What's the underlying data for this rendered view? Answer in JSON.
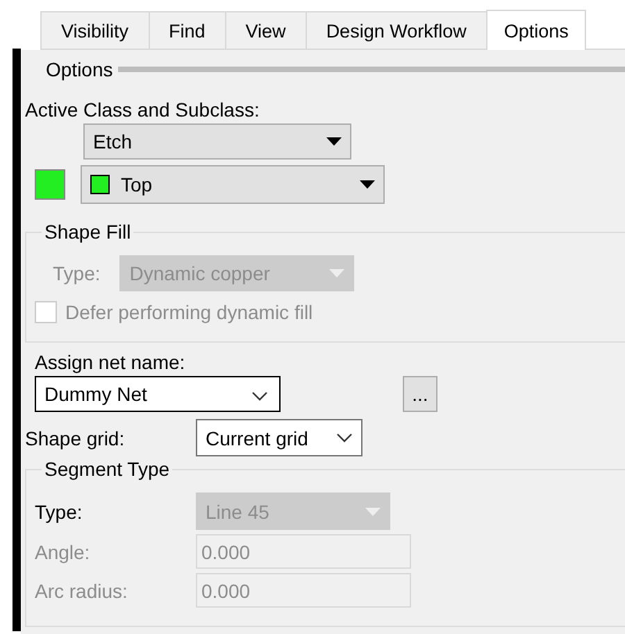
{
  "tabs": [
    {
      "label": "Visibility",
      "selected": false
    },
    {
      "label": "Find",
      "selected": false
    },
    {
      "label": "View",
      "selected": false
    },
    {
      "label": "Design Workflow",
      "selected": false
    },
    {
      "label": "Options",
      "selected": true
    }
  ],
  "section_title": "Options",
  "active_class": {
    "label": "Active Class and Subclass:",
    "class_value": "Etch",
    "subclass_value": "Top",
    "color": "#22ee22"
  },
  "shape_fill": {
    "title": "Shape Fill",
    "type_label": "Type:",
    "type_value": "Dynamic copper",
    "disabled": true,
    "defer": {
      "label": "Defer performing dynamic fill",
      "checked": false,
      "disabled": true
    }
  },
  "net": {
    "label": "Assign net name:",
    "value": "Dummy Net",
    "browse": "..."
  },
  "shape_grid": {
    "label": "Shape grid:",
    "value": "Current grid"
  },
  "segment_type": {
    "title": "Segment Type",
    "rows": [
      {
        "kind": "dropdown",
        "label": "Type:",
        "value": "Line 45",
        "disabled": true,
        "label_dimmed": false
      },
      {
        "kind": "text",
        "label": "Angle:",
        "value": "0.000",
        "disabled": true,
        "label_dimmed": true
      },
      {
        "kind": "text",
        "label": "Arc radius:",
        "value": "0.000",
        "disabled": true,
        "label_dimmed": true
      }
    ]
  }
}
